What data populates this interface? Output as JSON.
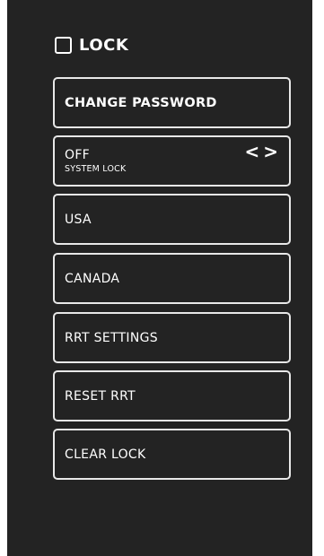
{
  "header": {
    "title": "LOCK"
  },
  "buttons": [
    {
      "label": "CHANGE PASSWORD"
    },
    {
      "label": "OFF",
      "sublabel": "SYSTEM LOCK",
      "prev_symbol": "<",
      "next_symbol": ">"
    },
    {
      "label": "USA"
    },
    {
      "label": "CANADA"
    },
    {
      "label": "RRT SETTINGS"
    },
    {
      "label": "RESET RRT"
    },
    {
      "label": "CLEAR LOCK"
    }
  ],
  "colors": {
    "panel_background": "#232323",
    "border": "#e8e8e8",
    "text": "#ffffff"
  }
}
